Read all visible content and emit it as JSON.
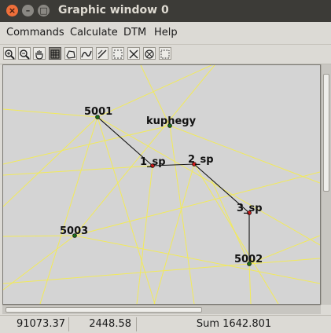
{
  "window": {
    "title": "Graphic window 0",
    "close_glyph": "×",
    "minimize_glyph": "–",
    "maximize_glyph": "□"
  },
  "menu": {
    "items": [
      "Commands",
      "Calculate",
      "DTM",
      "Help"
    ]
  },
  "toolbar": {
    "icons": [
      "zoom-in-icon",
      "zoom-out-icon",
      "pan-hand-icon",
      "grid-icon",
      "polygon-icon",
      "curve-icon",
      "line-select-icon",
      "dashed-box-icon",
      "cross-icon",
      "circle-cross-icon",
      "frame-icon"
    ],
    "pressed": "grid-icon"
  },
  "points": [
    {
      "label": "5001",
      "color": "#1a6b1a"
    },
    {
      "label": "kuphegy",
      "color": "#1a6b1a"
    },
    {
      "label": "1_sp",
      "color": "#cc1a1a"
    },
    {
      "label": "2_sp",
      "color": "#cc1a1a"
    },
    {
      "label": "3_sp",
      "color": "#cc1a1a"
    },
    {
      "label": "5002",
      "color": "#1a6b1a"
    },
    {
      "label": "5003",
      "color": "#1a6b1a"
    }
  ],
  "colors": {
    "canvas_bg": "#d4d4d4",
    "ray_line": "#f2ea5a",
    "traverse_line": "#111111"
  },
  "status": {
    "x_coord": "91073.37",
    "y_coord": "2448.58",
    "sum": "Sum 1642.801"
  }
}
